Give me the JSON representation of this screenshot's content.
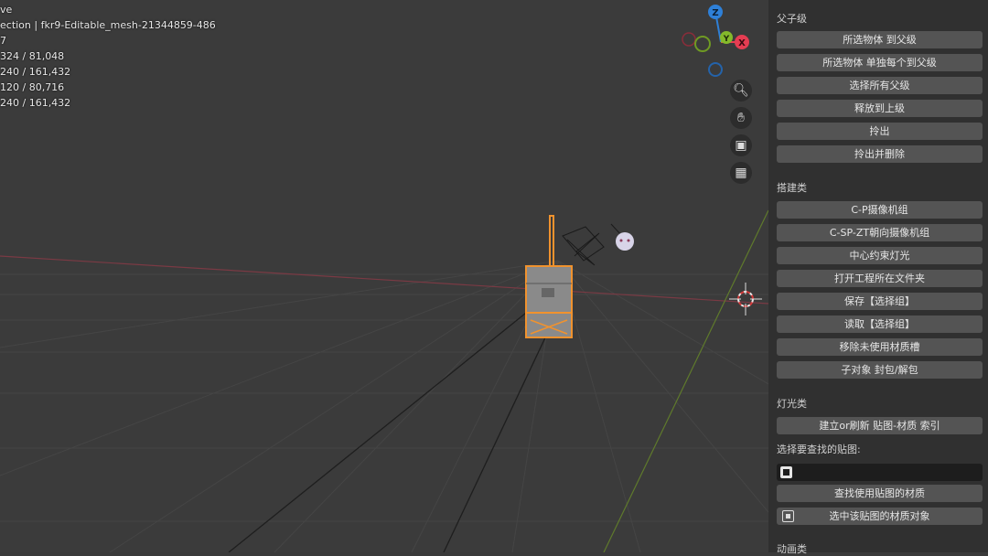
{
  "viewport": {
    "stats": [
      "ve",
      "ection | fkr9-Editable_mesh-21344859-486",
      "7",
      "324 / 81,048",
      "240 / 161,432",
      "120 / 80,716",
      "240 / 161,432"
    ],
    "gizmo_labels": {
      "z": "Z",
      "y": "Y",
      "x": "X"
    },
    "nav_icons": [
      "zoom-icon",
      "hand-pan-icon",
      "camera-icon",
      "grid-perspective-icon"
    ]
  },
  "panel": {
    "section1_title": "父子级",
    "section1_buttons": [
      "所选物体 到父级",
      "所选物体 单独每个到父级",
      "选择所有父级",
      "释放到上级",
      "拎出",
      "拎出并删除"
    ],
    "section2_title": "搭建类",
    "section2_buttons": [
      "C-P摄像机组",
      "C-SP-ZT朝向摄像机组",
      "中心约束灯光",
      "打开工程所在文件夹",
      "保存【选择组】",
      "读取【选择组】",
      "移除未使用材质槽",
      "子对象 封包/解包"
    ],
    "section3_title": "灯光类",
    "index_button": "建立or刷新 贴图-材质 索引",
    "texture_label": "选择要查找的贴图:",
    "find_button": "查找使用贴图的材质",
    "select_button": "选中该贴图的材质对象",
    "section4_title": "动画类"
  },
  "colors": {
    "selection": "#f0922e",
    "x_axis": "#e63d52",
    "y_axis": "#84b92b",
    "z_axis": "#2e80d8"
  }
}
